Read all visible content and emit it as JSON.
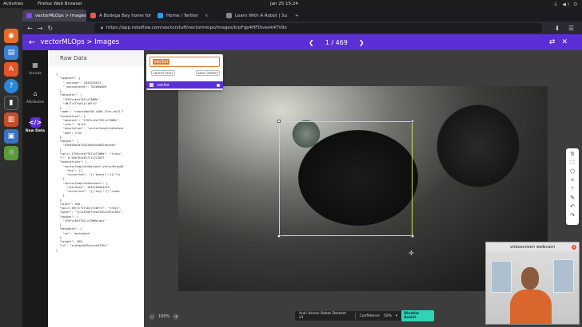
{
  "system": {
    "activities": "Activities",
    "app_name": "Firefox Web Browser",
    "clock": "Jan 25  15:24"
  },
  "browser": {
    "tabs": [
      {
        "label": "vectorMLOps > Images",
        "active": true
      },
      {
        "label": "A Bodega Bay home for",
        "active": false
      },
      {
        "label": "Home / Twitter",
        "active": false
      },
      {
        "label": "Learn With A Robot | Su",
        "active": false
      }
    ],
    "url": "https://app.roboflow.com/vectorstuff/vectormlops/images/krpFqp4HFDivenk4TV9x"
  },
  "app": {
    "breadcrumb": "vectorMLOps > Images",
    "pager": "1 / 469",
    "nav": [
      {
        "label": "Annots",
        "icon": "annotate-icon"
      },
      {
        "label": "Attributes",
        "icon": "tag-icon"
      },
      {
        "label": "Raw Data",
        "icon": "code-icon",
        "active": true
      }
    ]
  },
  "raw_data": {
    "title": "Raw Data",
    "json_text": "{\n  \"updated\": {\n    \"_seconds\": 1643255613,\n    \"_nanoseconds\": 762000000\n  },\n  \"datasets\": [\n    \"1FhPccKeYT611zTZWMe\",\n    \"xMjTcfIfu61jt1WfrS\"\n  ],\n  \"name\": \"robotdbec58-a286-47ce-ae13-7\n  \"annotation\": {\n    \"dataset\": \"1FhPccKeYT611zTZWMe\",\n    \"json\": false,\n    \"annotation\": \"vectorCompleteDatase\n    \"add\": true\n  },\n  \"bashes\": [\n    \"d3ee6be4af2037be64c6d02eeid5b\"\n  ],\n  \"split.1FhPccKeYT611zTZWMe\": \"train\",\n  \"r\": 0.0667644637211223657,\n  \"annotations\": {\n    \"vectorCompleteDataset-VectorBrandD\n      \"key\": [],\n      \"converted\": \"{\\\"boxes\\\":[{\\\"la\n    },\n    \"vectorCompleteDataset\": {\n      \"lastUsed\": 1632169864929,\n      \"converted\": \"{\\\"key\\\":[\\\"robot\n    }\n  },\n  \"width\": 640,\n  \"split.xMjTcfIfu61jt1WfrS\": \"train\",\n  \"owner\": \"jL2sE2mPffeaV19Gi1GYxx9d1\",\n  \"bashes\": [\n    \"1FhPccKeYT611zTZWMe/api\"\n  ],\n  \"metadata\": {\n    \"no\": \"metadata\"\n  },\n  \"height\": 360,\n  \"id\": \"krpFqp4HFDivenk4TV9x\"\n}"
  },
  "label_popup": {
    "input_value": "vector",
    "cancel_label": "cancel (esc)",
    "save_label": "save (enter)",
    "suggestion": "vector"
  },
  "toolbar": {
    "icons": [
      "hand-icon",
      "bbox-icon",
      "polygon-icon",
      "smart-polygon-icon",
      "magic-wand-icon",
      "pen-icon",
      "undo-icon",
      "redo-icon"
    ]
  },
  "footer": {
    "zoom_level": "100%",
    "dataset_name": "Anki Vector Robot Dataset v1",
    "confidence_label": "Confidence",
    "confidence_value": "50%",
    "disable_assist_label": "Disable Assist"
  },
  "webcam": {
    "title": "vokoscreen webcam"
  },
  "colors": {
    "accent": "#5b2fd6",
    "bbox": "#d7e25a",
    "assist": "#2fd3b5"
  }
}
